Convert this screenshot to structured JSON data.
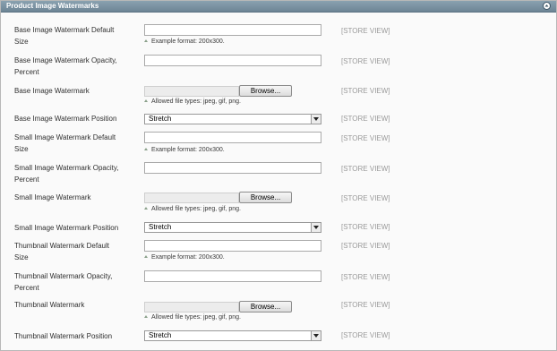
{
  "panel": {
    "title": "Product Image Watermarks",
    "collapse_icon": "chevron-up-icon"
  },
  "fields": [
    {
      "label_line1": "Base Image Watermark Default",
      "label_line2": "Size",
      "type": "text",
      "value": "",
      "note": "Example format: 200x300.",
      "scope": "[STORE VIEW]"
    },
    {
      "label_line1": "Base Image Watermark Opacity,",
      "label_line2": "Percent",
      "type": "text",
      "value": "",
      "scope": "[STORE VIEW]"
    },
    {
      "label_line1": "Base Image Watermark",
      "label_line2": "",
      "type": "file",
      "button": "Browse...",
      "note": "Allowed file types: jpeg, gif, png.",
      "scope": "[STORE VIEW]"
    },
    {
      "label_line1": "Base Image Watermark Position",
      "label_line2": "",
      "type": "select",
      "value": "Stretch",
      "scope": "[STORE VIEW]"
    },
    {
      "label_line1": "Small Image Watermark Default",
      "label_line2": "Size",
      "type": "text",
      "value": "",
      "note": "Example format: 200x300.",
      "scope": "[STORE VIEW]"
    },
    {
      "label_line1": "Small Image Watermark Opacity,",
      "label_line2": "Percent",
      "type": "text",
      "value": "",
      "scope": "[STORE VIEW]"
    },
    {
      "label_line1": "Small Image Watermark",
      "label_line2": "",
      "type": "file",
      "button": "Browse...",
      "note": "Allowed file types: jpeg, gif, png.",
      "scope": "[STORE VIEW]"
    },
    {
      "label_line1": "Small Image Watermark Position",
      "label_line2": "",
      "type": "select",
      "value": "Stretch",
      "scope": "[STORE VIEW]"
    },
    {
      "label_line1": "Thumbnail Watermark Default",
      "label_line2": "Size",
      "type": "text",
      "value": "",
      "note": "Example format: 200x300.",
      "scope": "[STORE VIEW]"
    },
    {
      "label_line1": "Thumbnail Watermark Opacity,",
      "label_line2": "Percent",
      "type": "text",
      "value": "",
      "scope": "[STORE VIEW]"
    },
    {
      "label_line1": "Thumbnail Watermark",
      "label_line2": "",
      "type": "file",
      "button": "Browse...",
      "note": "Allowed file types: jpeg, gif, png.",
      "scope": "[STORE VIEW]"
    },
    {
      "label_line1": "Thumbnail Watermark Position",
      "label_line2": "",
      "type": "select",
      "value": "Stretch",
      "scope": "[STORE VIEW]"
    }
  ],
  "colors": {
    "header_bg": "#7a8f9e",
    "scope_text": "#9a9a9a",
    "note_icon": "#8aa08a"
  }
}
